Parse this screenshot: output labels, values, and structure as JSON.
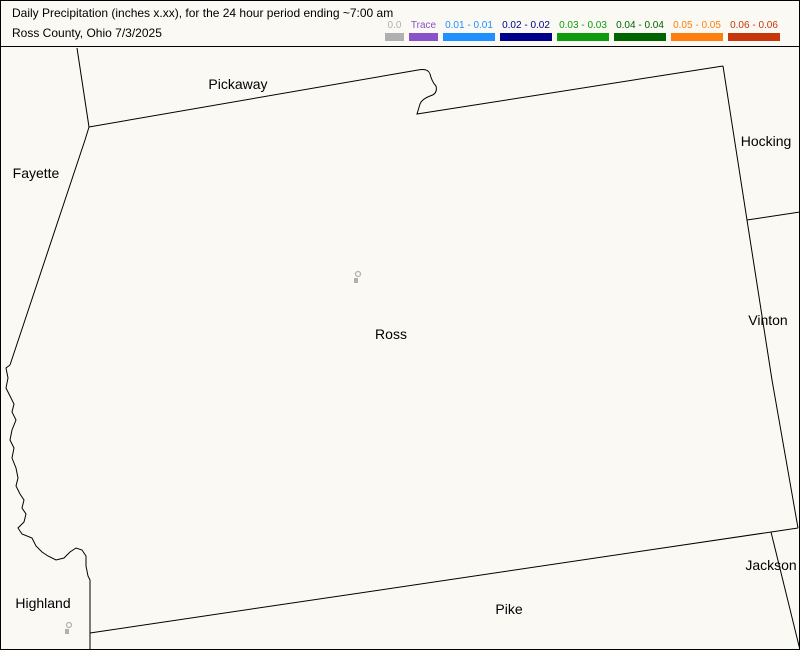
{
  "header": {
    "title": "Daily Precipitation (inches  x.xx),  for the 24 hour period ending ~7:00 am",
    "subtitle": "Ross County, Ohio  7/3/2025"
  },
  "legend": [
    {
      "label": "0.0",
      "color": "#b0b0b0"
    },
    {
      "label": "Trace",
      "color": "#8a52c9"
    },
    {
      "label": "0.01 - 0.01",
      "color": "#1e90ff"
    },
    {
      "label": "0.02 - 0.02",
      "color": "#00008b"
    },
    {
      "label": "0.03 - 0.03",
      "color": "#0e9c0e"
    },
    {
      "label": "0.04 - 0.04",
      "color": "#006400"
    },
    {
      "label": "0.05 - 0.05",
      "color": "#ff7f0e"
    },
    {
      "label": "0.06 - 0.06",
      "color": "#c8360b"
    }
  ],
  "map": {
    "counties": {
      "pickaway": "Pickaway",
      "fayette": "Fayette",
      "hocking": "Hocking",
      "ross": "Ross",
      "vinton": "Vinton",
      "jackson": "Jackson",
      "highland": "Highland",
      "pike": "Pike"
    },
    "stations": [
      {
        "id": "station-ross",
        "color": "#b0b0b0"
      },
      {
        "id": "station-highland",
        "color": "#b0b0b0"
      }
    ]
  }
}
